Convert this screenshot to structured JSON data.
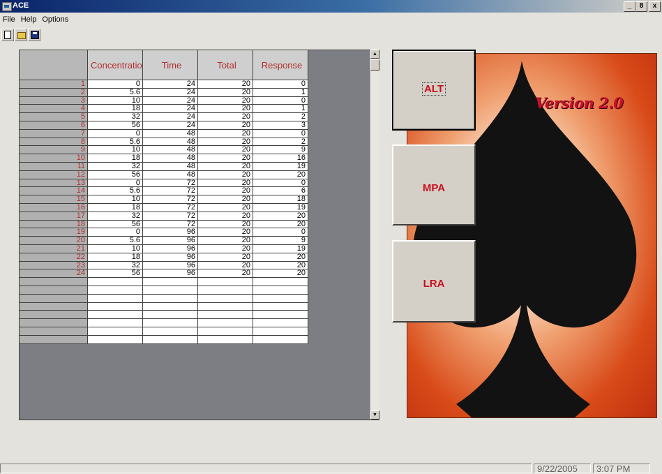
{
  "window": {
    "title": "ACE",
    "minimize": "_",
    "maximize": "8",
    "close": "x"
  },
  "menu": [
    "File",
    "Help",
    "Options"
  ],
  "toolbar": {
    "icons": [
      "new-file-icon",
      "open-folder-icon",
      "save-disk-icon"
    ]
  },
  "grid": {
    "columns": [
      "Concentratio",
      "Time",
      "Total",
      "Response"
    ],
    "rows": [
      {
        "n": "1",
        "c": "0",
        "t": "24",
        "tot": "20",
        "r": "0"
      },
      {
        "n": "2",
        "c": "5.6",
        "t": "24",
        "tot": "20",
        "r": "1"
      },
      {
        "n": "3",
        "c": "10",
        "t": "24",
        "tot": "20",
        "r": "0"
      },
      {
        "n": "4",
        "c": "18",
        "t": "24",
        "tot": "20",
        "r": "1"
      },
      {
        "n": "5",
        "c": "32",
        "t": "24",
        "tot": "20",
        "r": "2"
      },
      {
        "n": "6",
        "c": "56",
        "t": "24",
        "tot": "20",
        "r": "3"
      },
      {
        "n": "7",
        "c": "0",
        "t": "48",
        "tot": "20",
        "r": "0"
      },
      {
        "n": "8",
        "c": "5.6",
        "t": "48",
        "tot": "20",
        "r": "2"
      },
      {
        "n": "9",
        "c": "10",
        "t": "48",
        "tot": "20",
        "r": "9"
      },
      {
        "n": "10",
        "c": "18",
        "t": "48",
        "tot": "20",
        "r": "16"
      },
      {
        "n": "11",
        "c": "32",
        "t": "48",
        "tot": "20",
        "r": "19"
      },
      {
        "n": "12",
        "c": "56",
        "t": "48",
        "tot": "20",
        "r": "20"
      },
      {
        "n": "13",
        "c": "0",
        "t": "72",
        "tot": "20",
        "r": "0"
      },
      {
        "n": "14",
        "c": "5.6",
        "t": "72",
        "tot": "20",
        "r": "6"
      },
      {
        "n": "15",
        "c": "10",
        "t": "72",
        "tot": "20",
        "r": "18"
      },
      {
        "n": "16",
        "c": "18",
        "t": "72",
        "tot": "20",
        "r": "19"
      },
      {
        "n": "17",
        "c": "32",
        "t": "72",
        "tot": "20",
        "r": "20"
      },
      {
        "n": "18",
        "c": "56",
        "t": "72",
        "tot": "20",
        "r": "20"
      },
      {
        "n": "19",
        "c": "0",
        "t": "96",
        "tot": "20",
        "r": "0"
      },
      {
        "n": "20",
        "c": "5.6",
        "t": "96",
        "tot": "20",
        "r": "9"
      },
      {
        "n": "21",
        "c": "10",
        "t": "96",
        "tot": "20",
        "r": "19"
      },
      {
        "n": "22",
        "c": "18",
        "t": "96",
        "tot": "20",
        "r": "20"
      },
      {
        "n": "23",
        "c": "32",
        "t": "96",
        "tot": "20",
        "r": "20"
      },
      {
        "n": "24",
        "c": "56",
        "t": "96",
        "tot": "20",
        "r": "20"
      },
      {
        "n": "",
        "c": "",
        "t": "",
        "tot": "",
        "r": ""
      },
      {
        "n": "",
        "c": "",
        "t": "",
        "tot": "",
        "r": ""
      },
      {
        "n": "",
        "c": "",
        "t": "",
        "tot": "",
        "r": ""
      },
      {
        "n": "",
        "c": "",
        "t": "",
        "tot": "",
        "r": ""
      },
      {
        "n": "",
        "c": "",
        "t": "",
        "tot": "",
        "r": ""
      },
      {
        "n": "",
        "c": "",
        "t": "",
        "tot": "",
        "r": ""
      },
      {
        "n": "",
        "c": "",
        "t": "",
        "tot": "",
        "r": ""
      },
      {
        "n": "",
        "c": "",
        "t": "",
        "tot": "",
        "r": ""
      }
    ]
  },
  "buttons": {
    "alt": "ALT",
    "mpa": "MPA",
    "lra": "LRA"
  },
  "splash": {
    "version": "Version 2.0"
  },
  "status": {
    "date": "9/22/2005",
    "time": "3:07 PM"
  },
  "colors": {
    "accent": "#c81020",
    "titlebar": "#0a246a",
    "grid_bg": "#7c7e84"
  }
}
